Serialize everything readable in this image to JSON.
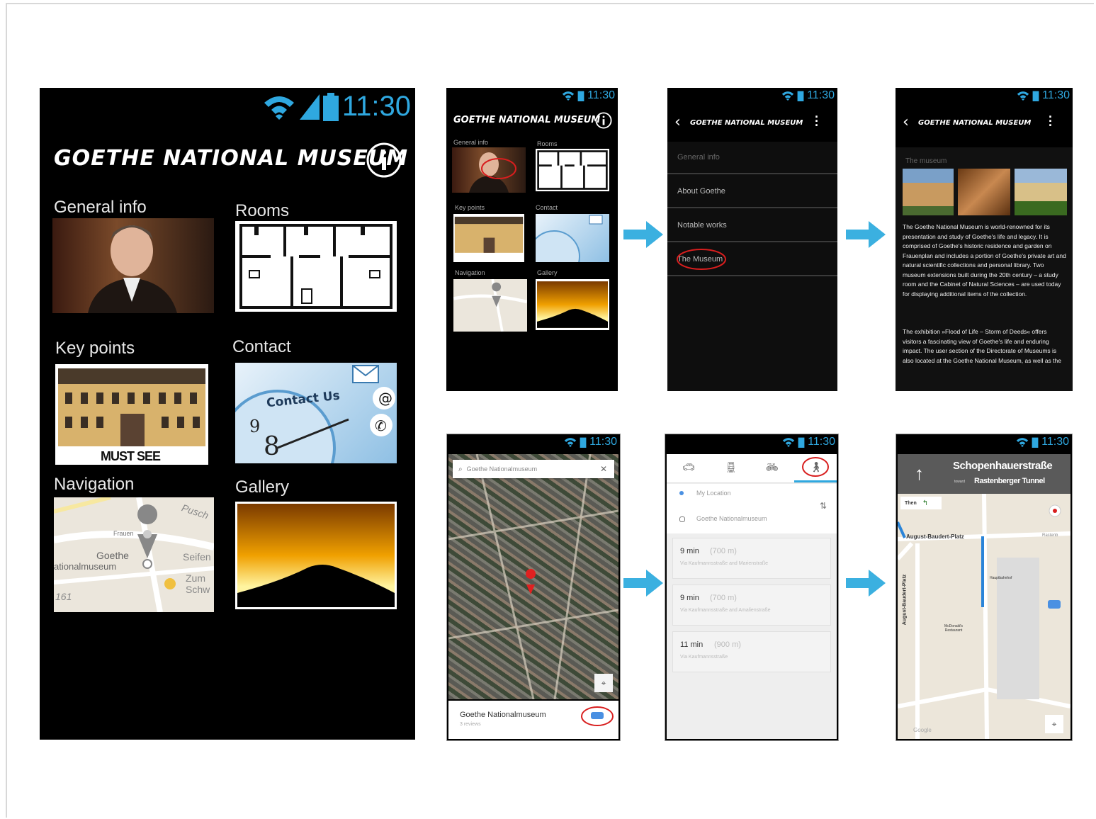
{
  "status": {
    "time": "11:30"
  },
  "main": {
    "title": "GOETHE NATIONAL MUSEUM",
    "tiles": {
      "general_info": "General info",
      "rooms": "Rooms",
      "key_points": "Key points",
      "contact": "Contact",
      "navigation": "Navigation",
      "gallery": "Gallery"
    },
    "contact_text": "Contact Us",
    "must_see": "MUST SEE",
    "map": {
      "label1": "Goethe",
      "label2": "ationalmuseum",
      "label3": "Pusch",
      "label4": "Seifen",
      "label5": "Zum",
      "label6": "Schw",
      "label7": "161",
      "label8": "Frauen"
    }
  },
  "menu": {
    "title": "GOETHE NATIONAL MUSEUM",
    "items": [
      "General info",
      "About Goethe",
      "Notable works",
      "The Museum"
    ]
  },
  "museum": {
    "title": "GOETHE NATIONAL MUSEUM",
    "section": "The museum",
    "para1": "The Goethe National Museum is world-renowned for its presentation and study of Goethe's life and legacy. It is comprised of Goethe's historic residence and garden on Frauenplan and includes a portion of Goethe's private art and natural scientific collections and personal library. Two museum extensions built during the 20th century – a study room and the Cabinet of Natural Sciences – are used today for displaying additional items of the collection.",
    "para2": "The exhibition »Flood of Life – Storm of Deeds« offers visitors a fascinating view of Goethe's life and enduring impact. The user section of the Directorate of Museums is also located at the Goethe National Museum, as well as the"
  },
  "mapsearch": {
    "search_value": "Goethe Nationalmuseum",
    "place_name": "Goethe Nationalmuseum",
    "place_sub": "3 reviews"
  },
  "directions": {
    "from": "My Location",
    "to": "Goethe Nationalmuseum",
    "routes": [
      {
        "time": "9 min",
        "dist": "(700 m)",
        "via": "Via Kaufmannsstraße and Marienstraße"
      },
      {
        "time": "9 min",
        "dist": "(700 m)",
        "via": "Via Kaufmannsstraße and Amalienstraße"
      },
      {
        "time": "11 min",
        "dist": "(900 m)",
        "via": "Via Kaufmannsstraße"
      }
    ]
  },
  "navigation": {
    "street": "Schopenhauerstraße",
    "toward_prefix": "toward",
    "toward": "Rastenberger Tunnel",
    "then": "Then",
    "map_labels": {
      "a": "August-Baudert-Platz",
      "b": "August-Baudert-Platz",
      "c": "Hauptbahnhof",
      "d": "McDonald's Restaurant",
      "e": "Google",
      "f": "Rastenb"
    }
  },
  "colors": {
    "accent": "#2fa8e0",
    "circle": "#d81e1e",
    "arrow": "#3bb0e0"
  }
}
